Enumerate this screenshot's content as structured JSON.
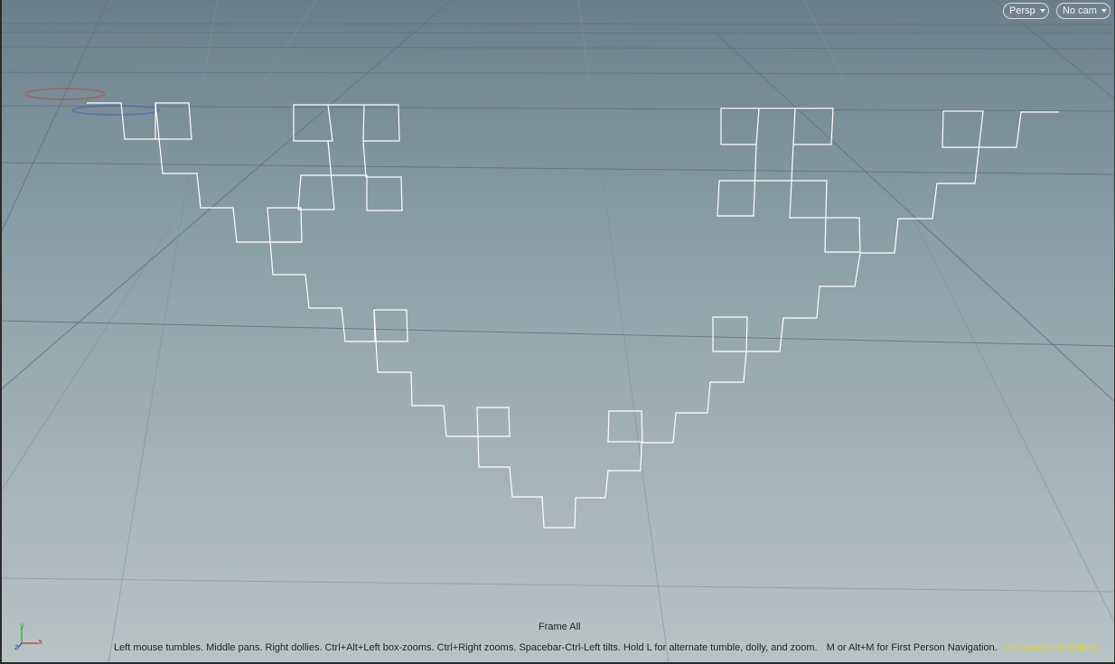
{
  "viewport": {
    "view_menu": "Persp",
    "camera_menu": "No cam",
    "frame_all_label": "Frame All",
    "status_message": "Left mouse tumbles. Middle pans. Right dollies. Ctrl+Alt+Left box-zooms. Ctrl+Right zooms. Spacebar-Ctrl-Left tilts. Hold L for alternate tumble, dolly, and zoom.",
    "status_nav_hint": "M or Alt+M for First Person Navigation.",
    "edition_label": "n-Commercial Edition",
    "axis_labels": {
      "x": "x",
      "y": "y",
      "z": "z"
    },
    "colors": {
      "curve": "#ffffff",
      "edition": "#e8d21c",
      "axis_x": "#d03030",
      "axis_y": "#30b030",
      "axis_z": "#3050d0"
    }
  }
}
